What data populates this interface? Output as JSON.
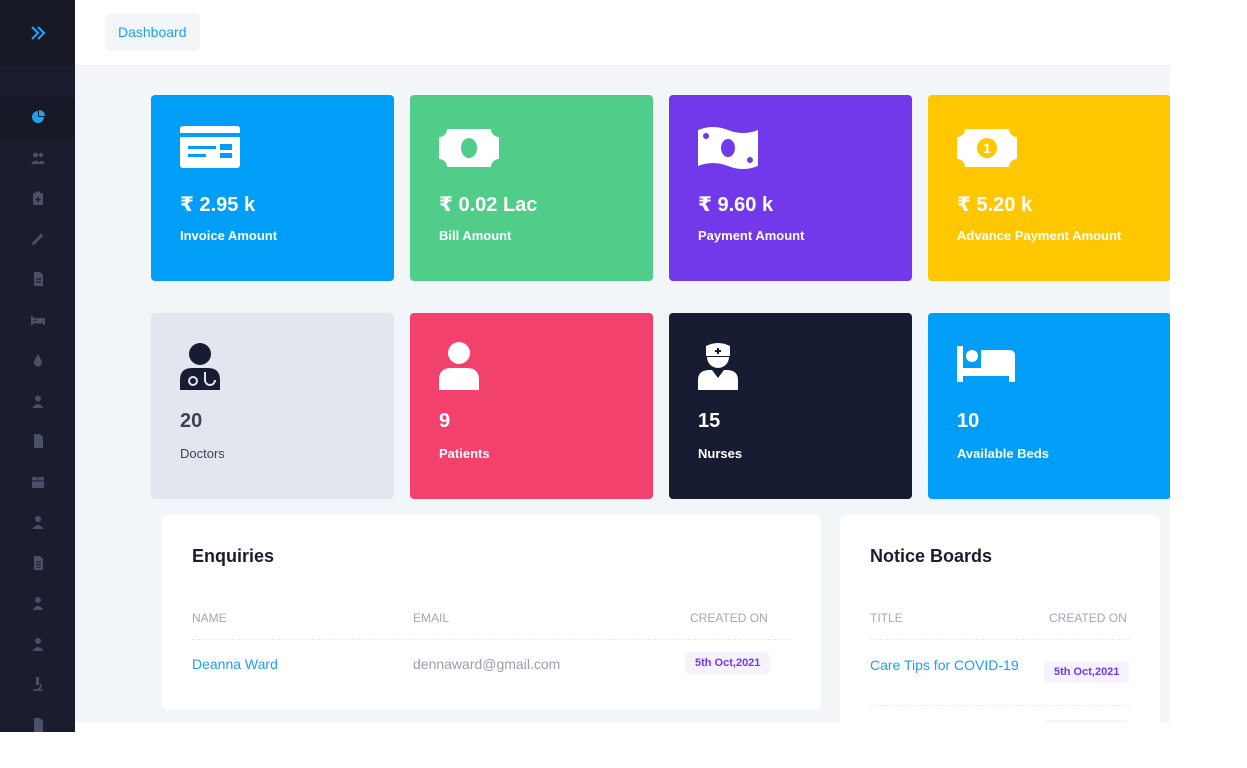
{
  "sidebar": {
    "toggle_icon": "double-chevron-right-icon",
    "items": [
      {
        "icon": "pie-chart-icon",
        "active": true
      },
      {
        "icon": "users-icon"
      },
      {
        "icon": "clipboard-plus-icon"
      },
      {
        "icon": "syringe-icon"
      },
      {
        "icon": "file-invoice-icon"
      },
      {
        "icon": "bed-icon"
      },
      {
        "icon": "blood-drop-icon"
      },
      {
        "icon": "user-nurse-icon"
      },
      {
        "icon": "file-icon"
      },
      {
        "icon": "box-icon"
      },
      {
        "icon": "user-doctor-icon"
      },
      {
        "icon": "file-lines-icon"
      },
      {
        "icon": "user-tie-icon"
      },
      {
        "icon": "user-icon"
      },
      {
        "icon": "microscope-icon"
      },
      {
        "icon": "file-prescription-icon"
      }
    ]
  },
  "breadcrumb": {
    "label": "Dashboard"
  },
  "stats": [
    {
      "value": "₹ 2.95 k",
      "label": "Invoice Amount",
      "icon": "invoice-icon",
      "color": "#009ef7"
    },
    {
      "value": "₹ 0.02 Lac",
      "label": "Bill Amount",
      "icon": "money-bill-icon",
      "color": "#50cd89"
    },
    {
      "value": "₹ 9.60 k",
      "label": "Payment Amount",
      "icon": "money-bill-wave-icon",
      "color": "#7239ea"
    },
    {
      "value": "₹ 5.20 k",
      "label": "Advance Payment Amount",
      "icon": "money-bill-coin-icon",
      "color": "#ffc700"
    },
    {
      "value": "20",
      "label": "Doctors",
      "icon": "doctor-icon",
      "color": "#e4e6ef"
    },
    {
      "value": "9",
      "label": "Patients",
      "icon": "patient-icon",
      "color": "#f1416c"
    },
    {
      "value": "15",
      "label": "Nurses",
      "icon": "nurse-icon",
      "color": "#181c32"
    },
    {
      "value": "10",
      "label": "Available Beds",
      "icon": "bed-icon",
      "color": "#009ef7"
    }
  ],
  "enquiries": {
    "title": "Enquiries",
    "columns": [
      "NAME",
      "EMAIL",
      "CREATED ON"
    ],
    "rows": [
      {
        "name": "Deanna Ward",
        "email": "dennaward@gmail.com",
        "created_on": "5th Oct,2021"
      }
    ]
  },
  "notice_boards": {
    "title": "Notice Boards",
    "columns": [
      "TITLE",
      "CREATED ON"
    ],
    "rows": [
      {
        "title": "Care Tips for COVID-19",
        "created_on": "5th Oct,2021"
      }
    ]
  }
}
